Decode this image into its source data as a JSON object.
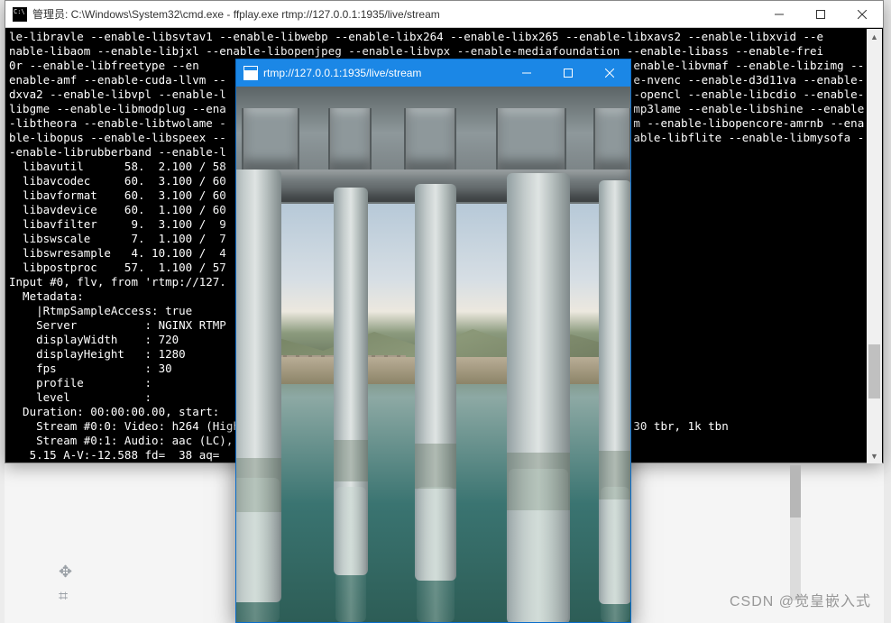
{
  "cmd": {
    "title": "管理员: C:\\Windows\\System32\\cmd.exe - ffplay.exe  rtmp://127.0.0.1:1935/live/stream",
    "lines": [
      "le-libravle --enable-libsvtav1 --enable-libwebp --enable-libx264 --enable-libx265 --enable-libxavs2 --enable-libxvid --e",
      "nable-libaom --enable-libjxl --enable-libopenjpeg --enable-libvpx --enable-mediafoundation --enable-libass --enable-frei",
      "0r --enable-libfreetype --en                                                                enable-libvmaf --enable-libzimg --",
      "enable-amf --enable-cuda-llvm --                                                            e-nvenc --enable-d3d11va --enable-",
      "dxva2 --enable-libvpl --enable-l                                                            -opencl --enable-libcdio --enable-",
      "libgme --enable-libmodplug --ena                                                            mp3lame --enable-libshine --enable",
      "-libtheora --enable-libtwolame -                                                            m --enable-libopencore-amrnb --ena",
      "ble-libopus --enable-libspeex --                                                            able-libflite --enable-libmysofa -",
      "-enable-librubberband --enable-l",
      "  libavutil      58.  2.100 / 58",
      "  libavcodec     60.  3.100 / 60",
      "  libavformat    60.  3.100 / 60",
      "  libavdevice    60.  1.100 / 60",
      "  libavfilter     9.  3.100 /  9",
      "  libswscale      7.  1.100 /  7",
      "  libswresample   4. 10.100 /  4",
      "  libpostproc    57.  1.100 / 57",
      "Input #0, flv, from 'rtmp://127.",
      "  Metadata:",
      "    |RtmpSampleAccess: true",
      "    Server          : NGINX RTMP",
      "    displayWidth    : 720",
      "    displayHeight   : 1280",
      "    fps             : 30",
      "    profile         :",
      "    level           :",
      "  Duration: 00:00:00.00, start:",
      "    Stream #0:0: Video: h264 (High                                                          30 tbr, 1k tbn",
      "    Stream #0:1: Audio: aac (LC),",
      "   5.15 A-V:-12.588 fd=  38 aq="
    ]
  },
  "media": {
    "title": "rtmp://127.0.0.1:1935/live/stream"
  },
  "watermark": "CSDN @觉皇嵌入式",
  "icons": {
    "minimize": "minimize",
    "maximize": "maximize",
    "close": "close",
    "move": "✥",
    "grid": "⌗"
  }
}
